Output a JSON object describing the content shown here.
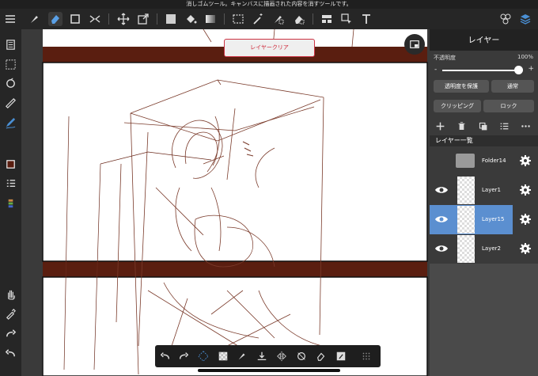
{
  "status_message": "消しゴムツール。キャンバスに描画された内容を消すツールです。",
  "toast": "レイヤークリア",
  "panel": {
    "title": "レイヤー",
    "opacity_label": "不透明度",
    "opacity_value": "100%",
    "opacity_minus": "-",
    "opacity_plus": "+",
    "opacity_level": 1.0,
    "protect_alpha": "透明度を保護",
    "blend_mode": "通常",
    "clipping": "クリッピング",
    "lock": "ロック",
    "list_header": "レイヤー一覧",
    "layers": [
      {
        "name": "Folder14",
        "type": "folder",
        "visible": false,
        "selected": false
      },
      {
        "name": "Layer1",
        "type": "layer",
        "visible": true,
        "selected": false
      },
      {
        "name": "Layer15",
        "type": "layer",
        "visible": true,
        "selected": true
      },
      {
        "name": "Layer2",
        "type": "layer",
        "visible": true,
        "selected": false
      }
    ]
  },
  "colors": {
    "accent": "#4a8fd4",
    "selected_row": "#5b8fd0",
    "toast_border": "#cc3344",
    "frame_brown": "#5a1e10"
  }
}
